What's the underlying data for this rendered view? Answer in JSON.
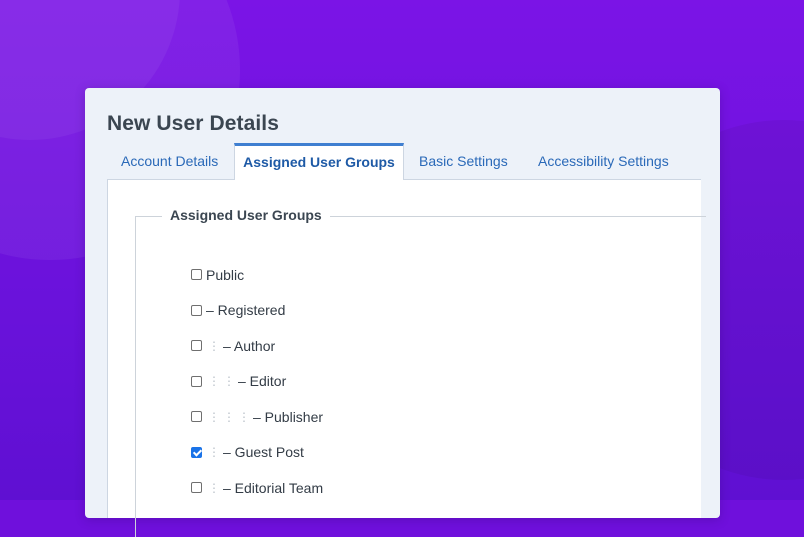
{
  "panel": {
    "title": "New User Details"
  },
  "tabs": [
    {
      "label": "Account Details",
      "active": false
    },
    {
      "label": "Assigned User Groups",
      "active": true
    },
    {
      "label": "Basic Settings",
      "active": false
    },
    {
      "label": "Accessibility Settings",
      "active": false
    }
  ],
  "fieldset": {
    "legend": "Assigned User Groups"
  },
  "groups": [
    {
      "label": "Public",
      "depth": 0,
      "checked": false
    },
    {
      "label": "– Registered",
      "depth": 0,
      "checked": false
    },
    {
      "label": "– Author",
      "depth": 1,
      "checked": false
    },
    {
      "label": "– Editor",
      "depth": 2,
      "checked": false
    },
    {
      "label": "– Publisher",
      "depth": 3,
      "checked": false
    },
    {
      "label": "– Guest Post",
      "depth": 1,
      "checked": true
    },
    {
      "label": "– Editorial Team",
      "depth": 1,
      "checked": false
    }
  ],
  "colors": {
    "background": "#6f10dc",
    "accent": "#3f7fd1",
    "link": "#2a69b8",
    "checked": "#1a73e8"
  },
  "icons": {
    "tree_indent": "vertical-ellipsis-icon"
  }
}
